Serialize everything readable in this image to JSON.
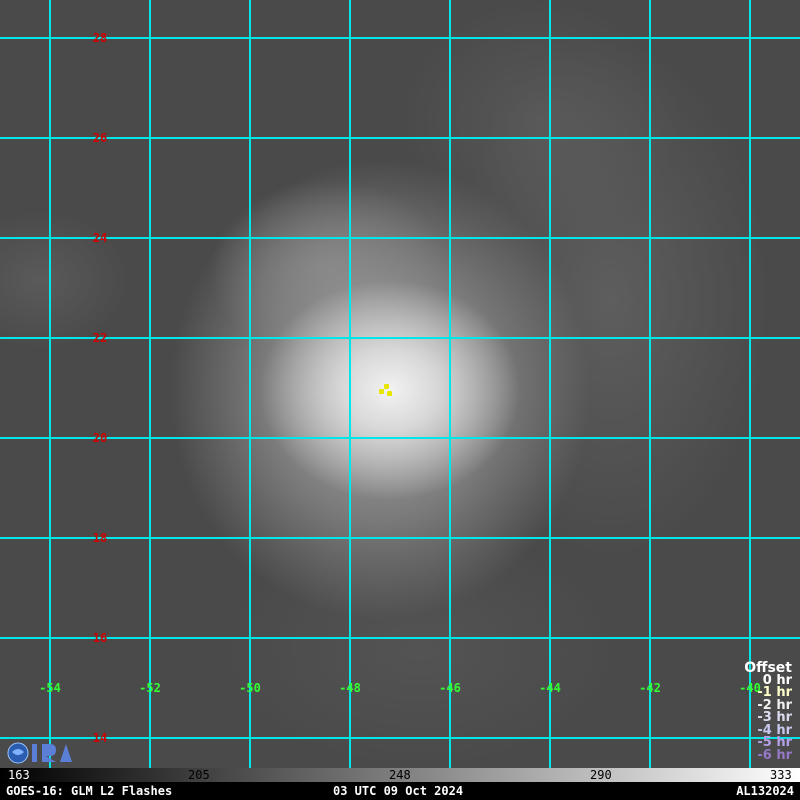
{
  "map": {
    "lat_lines": [
      {
        "lat": "28"
      },
      {
        "lat": "26"
      },
      {
        "lat": "24"
      },
      {
        "lat": "22"
      },
      {
        "lat": "20"
      },
      {
        "lat": "18"
      },
      {
        "lat": "16"
      },
      {
        "lat": "14"
      }
    ],
    "lon_lines": [
      {
        "lon": "-54"
      },
      {
        "lon": "-52"
      },
      {
        "lon": "-50"
      },
      {
        "lon": "-48"
      },
      {
        "lon": "-46"
      },
      {
        "lon": "-44"
      },
      {
        "lon": "-42"
      },
      {
        "lon": "-40"
      }
    ],
    "grid_color": "#00e5e5",
    "lat_label_color": "#d10000",
    "lon_label_color": "#33ff33",
    "flash_color": "#e6e600"
  },
  "offset_legend": {
    "title": "Offset",
    "items": [
      {
        "label": "0 hr",
        "color": "#ffffff"
      },
      {
        "label": "-1 hr",
        "color": "#ffffcc"
      },
      {
        "label": "-2 hr",
        "color": "#f0f0f0"
      },
      {
        "label": "-3 hr",
        "color": "#dcdcf0"
      },
      {
        "label": "-4 hr",
        "color": "#c8c8f0"
      },
      {
        "label": "-5 hr",
        "color": "#b4a0e6"
      },
      {
        "label": "-6 hr",
        "color": "#9678c8"
      }
    ]
  },
  "colorbar": {
    "ticks": [
      "163",
      "205",
      "248",
      "290",
      "333"
    ]
  },
  "footer": {
    "left": "GOES-16: GLM L2 Flashes",
    "center": "03 UTC 09 Oct 2024",
    "right": "AL132024"
  }
}
